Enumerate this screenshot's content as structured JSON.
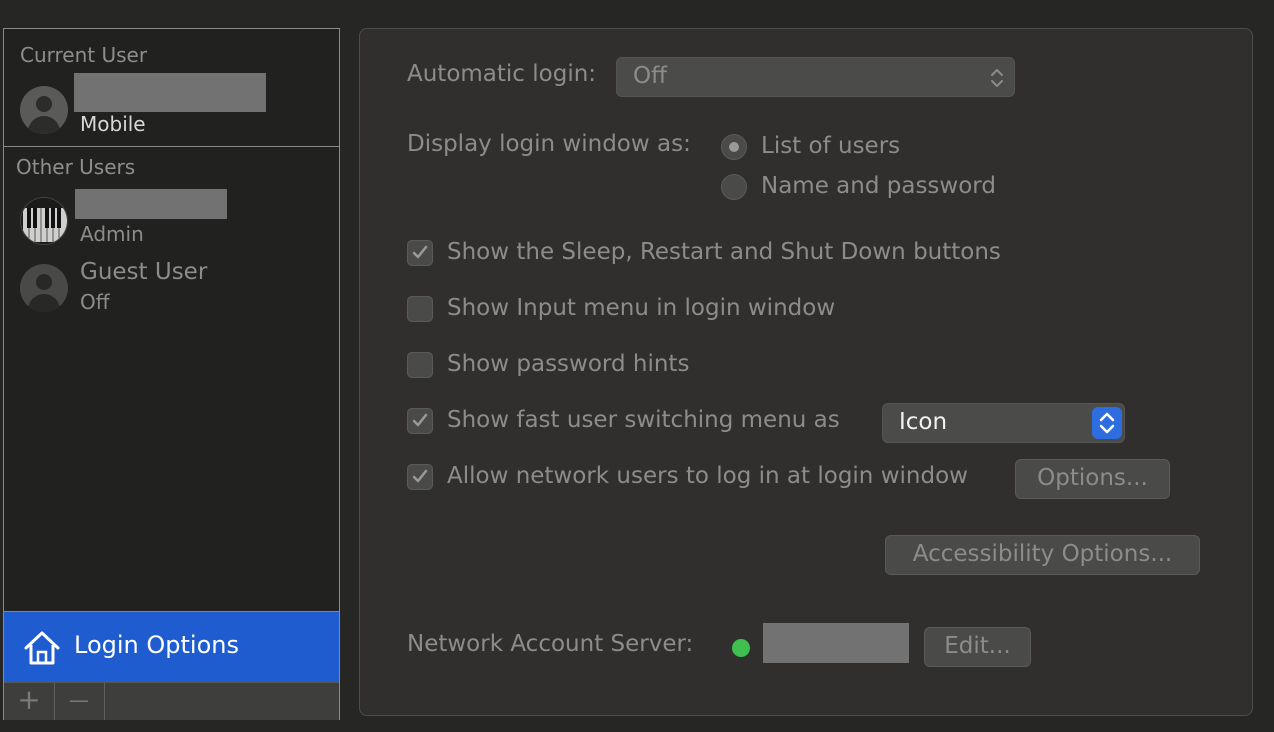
{
  "sidebar": {
    "current_user_header": "Current User",
    "current_user": {
      "role": "Mobile"
    },
    "other_users_header": "Other Users",
    "other_users": [
      {
        "role": "Admin"
      },
      {
        "name": "Guest User",
        "role": "Off"
      }
    ],
    "login_options_label": "Login Options",
    "add_symbol": "+",
    "remove_symbol": "—"
  },
  "panel": {
    "automatic_login": {
      "label": "Automatic login:",
      "value": "Off"
    },
    "display_login": {
      "label": "Display login window as:",
      "options": [
        "List of users",
        "Name and password"
      ],
      "selected": 0
    },
    "checkboxes": [
      {
        "label": "Show the Sleep, Restart and Shut Down buttons",
        "checked": true
      },
      {
        "label": "Show Input menu in login window",
        "checked": false
      },
      {
        "label": "Show password hints",
        "checked": false
      },
      {
        "label": "Show fast user switching menu as",
        "checked": true
      },
      {
        "label": "Allow network users to log in at login window",
        "checked": true
      }
    ],
    "fast_switch_value": "Icon",
    "options_button": "Options...",
    "accessibility_button": "Accessibility Options...",
    "network_server": {
      "label": "Network Account Server:",
      "status_color": "#3fbf4f",
      "edit_button": "Edit..."
    }
  },
  "colors": {
    "accent": "#1f5ccf",
    "status_green": "#3fbf4f"
  }
}
